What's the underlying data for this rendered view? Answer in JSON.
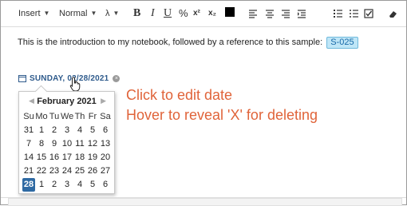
{
  "toolbar": {
    "insert_label": "Insert",
    "format_label": "Normal",
    "math_label": "λ",
    "bold": "B",
    "italic": "I",
    "underline": "U",
    "link_glyph": "%",
    "superscript": "x²",
    "subscript": "x₂",
    "color_swatch": "#000000"
  },
  "editor": {
    "intro_text": "This is the introduction to my notebook, followed by a reference to this sample:",
    "sample_tag": "S-025"
  },
  "date_field": {
    "label": "SUNDAY, 02/28/2021",
    "delete_glyph": "×"
  },
  "hints": {
    "line1": "Click to edit date",
    "line2": "Hover to reveal 'X' for deleting"
  },
  "calendar": {
    "month_title": "February 2021",
    "prev_glyph": "◀",
    "next_glyph": "▶",
    "weekdays": [
      "Su",
      "Mo",
      "Tu",
      "We",
      "Th",
      "Fr",
      "Sa"
    ],
    "weeks": [
      [
        "31",
        "1",
        "2",
        "3",
        "4",
        "5",
        "6"
      ],
      [
        "7",
        "8",
        "9",
        "10",
        "11",
        "12",
        "13"
      ],
      [
        "14",
        "15",
        "16",
        "17",
        "18",
        "19",
        "20"
      ],
      [
        "21",
        "22",
        "23",
        "24",
        "25",
        "26",
        "27"
      ],
      [
        "28",
        "1",
        "2",
        "3",
        "4",
        "5",
        "6"
      ]
    ],
    "selected": "28"
  },
  "colors": {
    "accent": "#2f6aa3",
    "hint": "#e0643a",
    "tag_bg": "#bfe6f7"
  }
}
